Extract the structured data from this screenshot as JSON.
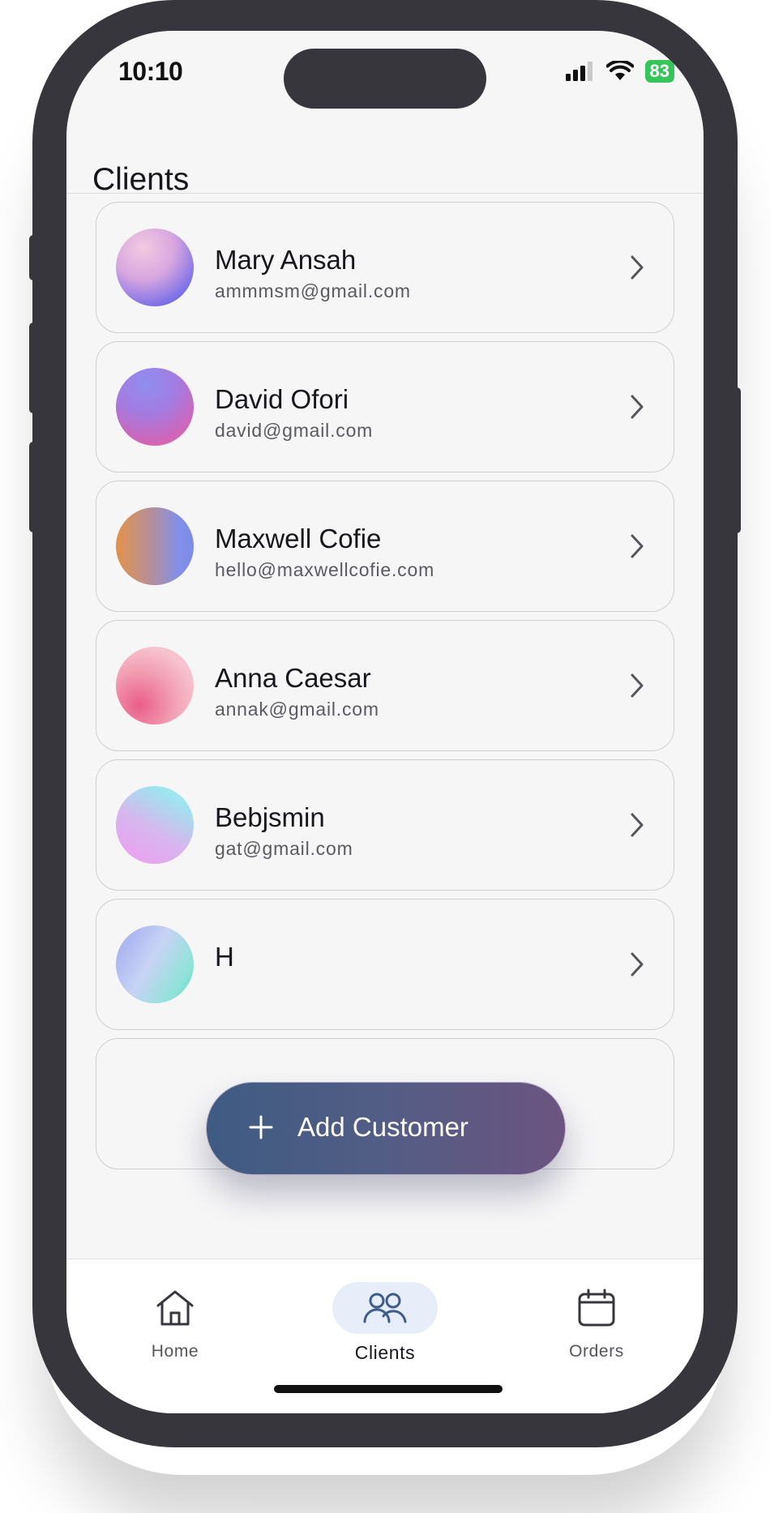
{
  "status_bar": {
    "time": "10:10",
    "battery": "83"
  },
  "header": {
    "title": "Clients"
  },
  "clients": [
    {
      "name": "Mary Ansah",
      "email": "ammmsm@gmail.com"
    },
    {
      "name": "David Ofori",
      "email": "david@gmail.com"
    },
    {
      "name": "Maxwell Cofie",
      "email": "hello@maxwellcofie.com"
    },
    {
      "name": "Anna Caesar",
      "email": "annak@gmail.com"
    },
    {
      "name": "Bebjsmin",
      "email": "gat@gmail.com"
    },
    {
      "name": "H",
      "email": ""
    }
  ],
  "fab": {
    "label": "Add Customer",
    "icon": "plus-icon"
  },
  "tabs": [
    {
      "label": "Home",
      "icon": "home-icon",
      "active": false
    },
    {
      "label": "Clients",
      "icon": "users-icon",
      "active": true
    },
    {
      "label": "Orders",
      "icon": "calendar-icon",
      "active": false
    }
  ],
  "colors": {
    "accent_start": "#3f5b82",
    "accent_end": "#6b5480",
    "active_tab_bg": "#e7edf9",
    "battery": "#36c55a"
  }
}
